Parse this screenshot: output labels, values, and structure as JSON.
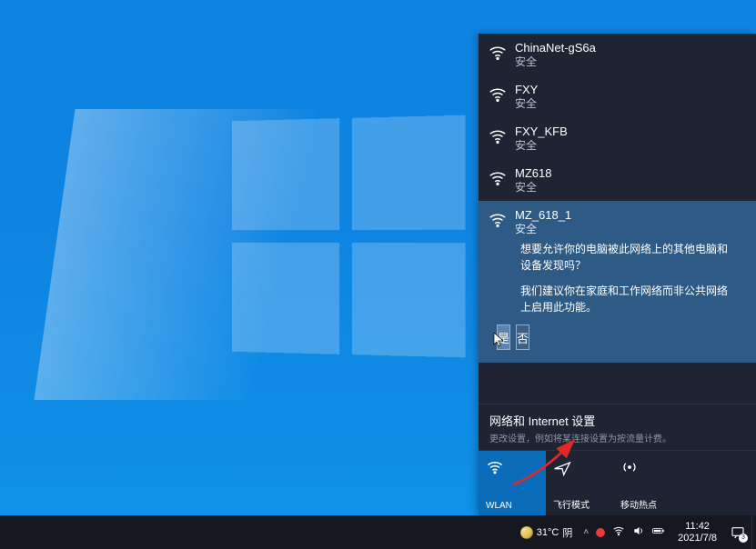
{
  "networks": [
    {
      "ssid": "ChinaNet-gS6a",
      "security": "安全"
    },
    {
      "ssid": "FXY",
      "security": "安全"
    },
    {
      "ssid": "FXY_KFB",
      "security": "安全"
    },
    {
      "ssid": "MZ618",
      "security": "安全"
    }
  ],
  "selected": {
    "ssid": "MZ_618_1",
    "security": "安全",
    "prompt_q": "想要允许你的电脑被此网络上的其他电脑和设备发现吗？",
    "prompt_rec": "我们建议你在家庭和工作网络而非公共网络上启用此功能。",
    "yes": "是",
    "no": "否"
  },
  "settings": {
    "title": "网络和 Internet 设置",
    "subtitle": "更改设置，例如将某连接设置为按流量计费。"
  },
  "tiles": {
    "wlan": "WLAN",
    "airplane": "飞行模式",
    "hotspot": "移动热点"
  },
  "taskbar": {
    "temp": "31°C",
    "weather": "阴",
    "time": "11:42",
    "date": "2021/7/8",
    "notif_count": "3"
  }
}
